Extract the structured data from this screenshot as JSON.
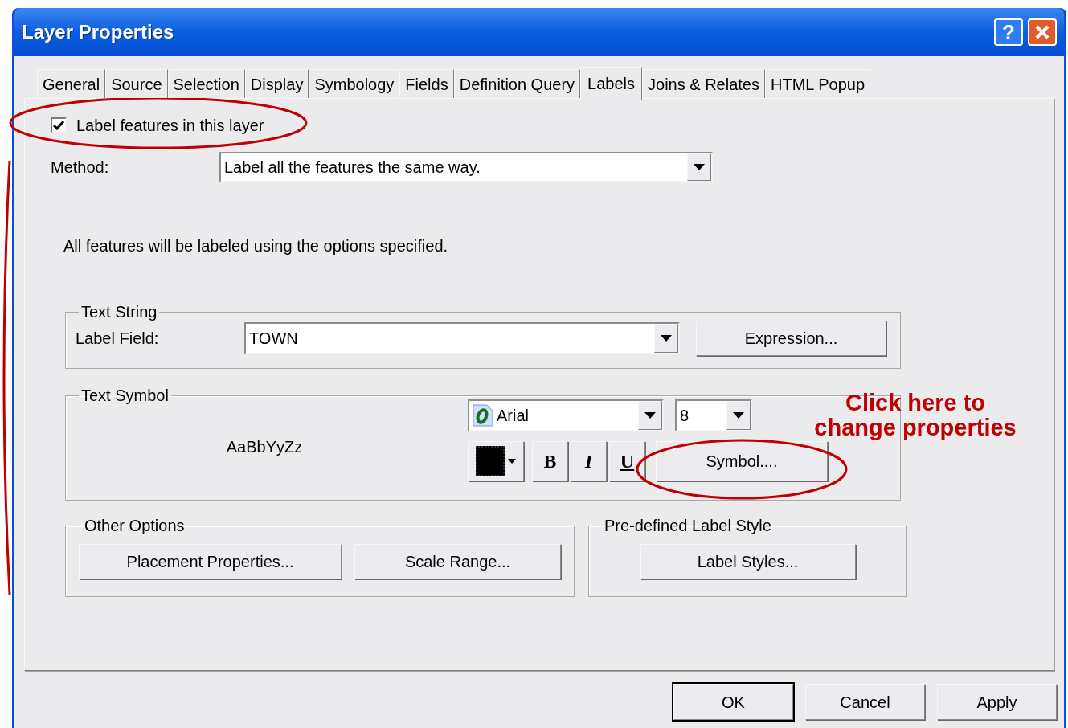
{
  "window": {
    "title": "Layer Properties",
    "help": "?"
  },
  "tabs": [
    {
      "label": "General",
      "selected": false
    },
    {
      "label": "Source",
      "selected": false
    },
    {
      "label": "Selection",
      "selected": false
    },
    {
      "label": "Display",
      "selected": false
    },
    {
      "label": "Symbology",
      "selected": false
    },
    {
      "label": "Fields",
      "selected": false
    },
    {
      "label": "Definition Query",
      "selected": false
    },
    {
      "label": "Labels",
      "selected": true
    },
    {
      "label": "Joins & Relates",
      "selected": false
    },
    {
      "label": "HTML Popup",
      "selected": false
    }
  ],
  "labels_tab": {
    "label_features": {
      "label": "Label features in this layer",
      "checked": true
    },
    "method": {
      "label": "Method:",
      "value": "Label all the features the same way."
    },
    "description": "All features will be labeled using the options specified.",
    "text_string": {
      "title": "Text String",
      "field_label": "Label Field:",
      "field_value": "TOWN",
      "expression_button": "Expression..."
    },
    "text_symbol": {
      "title": "Text Symbol",
      "preview": "AaBbYyZz",
      "font": "Arial",
      "size": "8",
      "color": "#000000",
      "bold": "B",
      "italic": "I",
      "underline": "U",
      "symbol_button": "Symbol...."
    },
    "other_options": {
      "title": "Other Options",
      "buttons": [
        "Placement Properties...",
        "Scale Range..."
      ]
    },
    "predefined_style": {
      "title": "Pre-defined Label Style",
      "button": "Label Styles..."
    }
  },
  "dialog_buttons": [
    {
      "label": "OK",
      "default": true
    },
    {
      "label": "Cancel",
      "default": false
    },
    {
      "label": "Apply",
      "default": false
    }
  ],
  "annotation": {
    "text": "Click here to\nchange properties"
  }
}
